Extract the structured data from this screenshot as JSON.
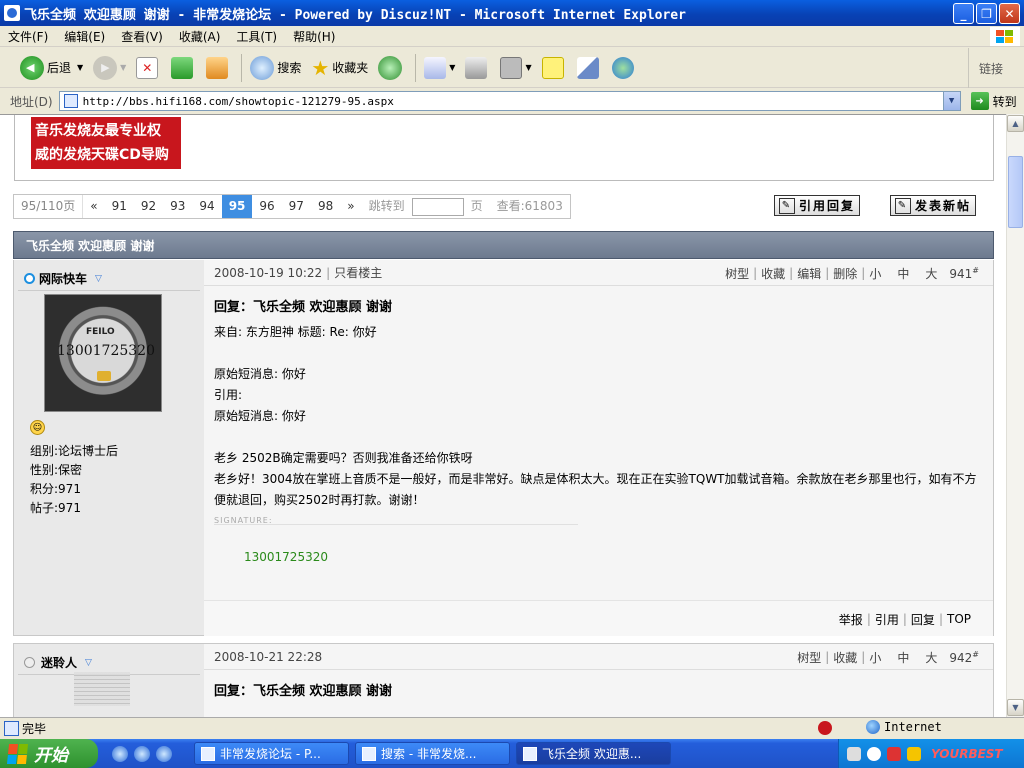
{
  "window": {
    "title": "飞乐全频 欢迎惠顾 谢谢 - 非常发烧论坛 - Powered by Discuz!NT - Microsoft Internet Explorer",
    "minimize": "_",
    "maximize": "❐",
    "close": "✕"
  },
  "menu": [
    "文件(F)",
    "编辑(E)",
    "查看(V)",
    "收藏(A)",
    "工具(T)",
    "帮助(H)"
  ],
  "toolbar": {
    "back": "后退",
    "search": "搜索",
    "favorites": "收藏夹",
    "links": "链接"
  },
  "address": {
    "label": "地址(D)",
    "url": "http://bbs.hifi168.com/showtopic-121279-95.aspx",
    "go": "转到"
  },
  "banner": {
    "line1": "音乐发烧友最专业权",
    "line2": "威的发烧天碟CD导购"
  },
  "pager": {
    "info": "95/110页",
    "prev": "«",
    "pages": [
      "91",
      "92",
      "93",
      "94",
      "95",
      "96",
      "97",
      "98"
    ],
    "current": "95",
    "next": "»",
    "jump_label": "跳转到",
    "page_unit": "页",
    "views": "查看:61803"
  },
  "actions": {
    "reply": "引用回复",
    "new_topic": "发表新帖"
  },
  "topic_title": "飞乐全频 欢迎惠顾 谢谢",
  "posts": [
    {
      "author": "网际快车",
      "avatar_brand": "FEILO",
      "avatar_text": "13001725320",
      "stats": [
        "组别:论坛博士后",
        "性别:保密",
        "积分:971",
        "帖子:971"
      ],
      "time": "2008-10-19 10:22",
      "only_author": "只看楼主",
      "tools": [
        "树型",
        "收藏",
        "编辑",
        "删除",
        "小",
        "中",
        "大"
      ],
      "floor": "941",
      "title": "回复：飞乐全频 欢迎惠顾 谢谢",
      "body": [
        "来自: 东方胆神  标题: Re: 你好",
        "",
        "原始短消息: 你好",
        "引用:",
        "原始短消息: 你好",
        "",
        "老乡  2502B确定需要吗？否则我准备还给你铁呀",
        "老乡好！3004放在掌班上音质不是一般好，而是非常好。缺点是体积太大。现在正在实验TQWT加载试音箱。余款放在老乡那里也行，如有不方便就退回，购买2502时再打款。谢谢！"
      ],
      "signature_label": "SIGNATURE:",
      "signature": "13001725320",
      "footer": [
        "举报",
        "引用",
        "回复",
        "TOP"
      ]
    },
    {
      "author": "迷聆人",
      "time": "2008-10-21 22:28",
      "tools": [
        "树型",
        "收藏",
        "小",
        "中",
        "大"
      ],
      "floor": "942",
      "title": "回复：飞乐全频 欢迎惠顾 谢谢"
    }
  ],
  "status": {
    "text": "完毕",
    "zone": "Internet"
  },
  "taskbar": {
    "start": "开始",
    "tasks": [
      "非常发烧论坛 - P...",
      "搜索 - 非常发烧...",
      "飞乐全频 欢迎惠..."
    ],
    "brand": "YOURBEST"
  }
}
